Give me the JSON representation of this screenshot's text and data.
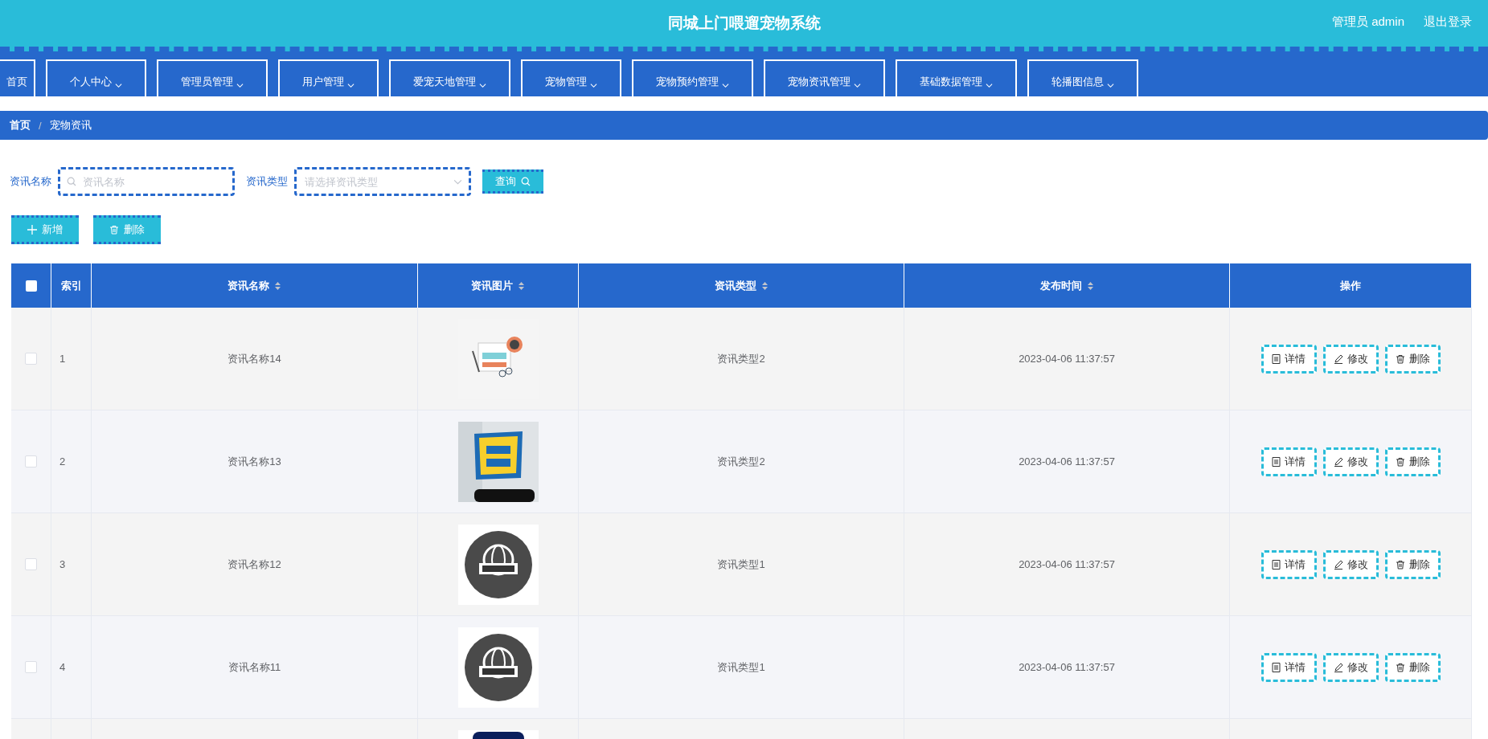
{
  "header": {
    "title": "同城上门喂遛宠物系统",
    "user": "管理员 admin",
    "logout": "退出登录"
  },
  "nav": [
    {
      "label": "首页",
      "has_menu": false
    },
    {
      "label": "个人中心",
      "has_menu": true
    },
    {
      "label": "管理员管理",
      "has_menu": true
    },
    {
      "label": "用户管理",
      "has_menu": true
    },
    {
      "label": "爱宠天地管理",
      "has_menu": true
    },
    {
      "label": "宠物管理",
      "has_menu": true
    },
    {
      "label": "宠物预约管理",
      "has_menu": true
    },
    {
      "label": "宠物资讯管理",
      "has_menu": true
    },
    {
      "label": "基础数据管理",
      "has_menu": true
    },
    {
      "label": "轮播图信息",
      "has_menu": true
    }
  ],
  "breadcrumb": {
    "items": [
      "首页",
      "宠物资讯"
    ],
    "separator": "/"
  },
  "search": {
    "name_label": "资讯名称",
    "name_placeholder": "资讯名称",
    "type_label": "资讯类型",
    "type_placeholder": "请选择资讯类型",
    "query_button": "查询"
  },
  "actions": {
    "add": "新增",
    "delete": "删除"
  },
  "table": {
    "select_all": {
      "checked": false
    },
    "columns": [
      {
        "label": "索引",
        "sortable": false
      },
      {
        "label": "资讯名称",
        "sortable": true
      },
      {
        "label": "资讯图片",
        "sortable": true
      },
      {
        "label": "资讯类型",
        "sortable": true
      },
      {
        "label": "发布时间",
        "sortable": true
      },
      {
        "label": "操作",
        "sortable": false
      }
    ],
    "rows": [
      {
        "checked": false,
        "index": "1",
        "name": "资讯名称14",
        "picture": {
          "kind": "picture"
        },
        "type": "资讯类型2",
        "time": "2023-04-06 11:37:57",
        "actions": [
          "详情",
          "修改",
          "删除"
        ]
      },
      {
        "checked": false,
        "index": "2",
        "name": "资讯名称13",
        "picture": {
          "kind": "picture"
        },
        "type": "资讯类型2",
        "time": "2023-04-06 11:37:57",
        "actions": [
          "详情",
          "修改",
          "删除"
        ]
      },
      {
        "checked": false,
        "index": "3",
        "name": "资讯名称12",
        "picture": {
          "kind": "picture"
        },
        "type": "资讯类型1",
        "time": "2023-04-06 11:37:57",
        "actions": [
          "详情",
          "修改",
          "删除"
        ]
      },
      {
        "checked": false,
        "index": "4",
        "name": "资讯名称11",
        "picture": {
          "kind": "picture"
        },
        "type": "资讯类型1",
        "time": "2023-04-06 11:37:57",
        "actions": [
          "详情",
          "修改",
          "删除"
        ]
      },
      {
        "picture": {
          "kind": "picture"
        }
      }
    ]
  }
}
